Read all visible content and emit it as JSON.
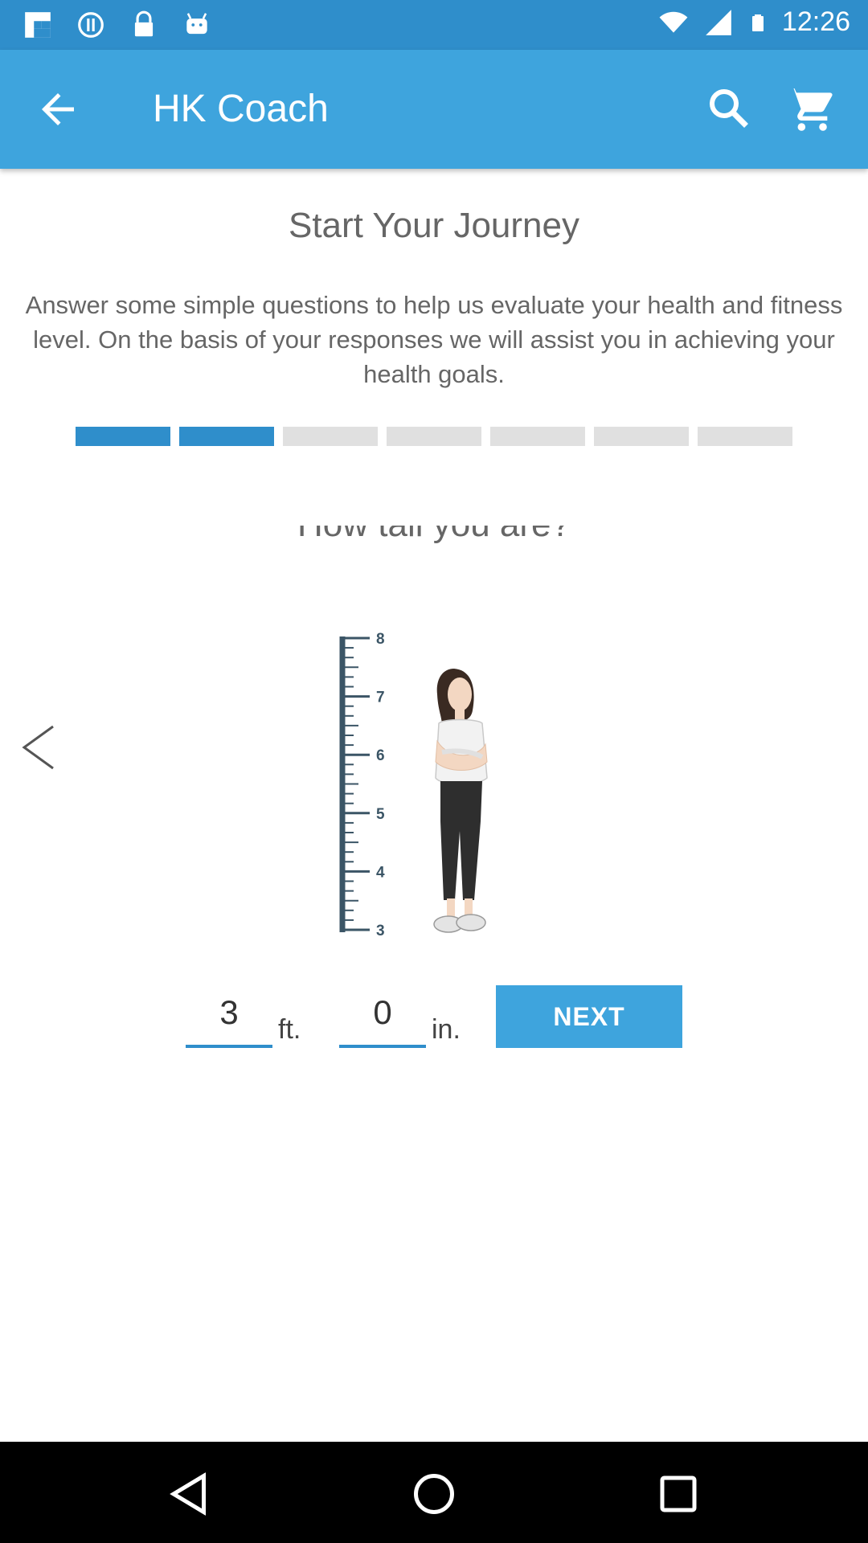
{
  "status_bar": {
    "time": "12:26",
    "left_icons": [
      "flipboard-icon",
      "info-icon",
      "lock-icon",
      "android-icon"
    ],
    "right_icons": [
      "wifi-icon",
      "signal-icon",
      "battery-icon"
    ]
  },
  "app_bar": {
    "title": "HK Coach",
    "back_icon": "arrow-back-icon",
    "search_icon": "search-icon",
    "cart_icon": "shopping-cart-icon"
  },
  "content": {
    "heading": "Start Your Journey",
    "description": "Answer some simple questions to help us evaluate your health and fitness level. On the basis of your responses we will assist you in achieving your health goals.",
    "progress": {
      "total_steps": 7,
      "completed_steps": 2
    },
    "question": "How tall you are?",
    "illustration": {
      "ruler_labels": [
        "8",
        "7",
        "6",
        "5",
        "4",
        "3"
      ]
    }
  },
  "height_form": {
    "feet_value": "3",
    "feet_unit": "ft.",
    "inches_value": "0",
    "inches_unit": "in.",
    "next_label": "NEXT"
  },
  "colors": {
    "status_bar": "#2f8ecb",
    "app_bar": "#3ea4dd",
    "accent": "#2f8ecb",
    "progress_inactive": "#e0e0e0"
  }
}
